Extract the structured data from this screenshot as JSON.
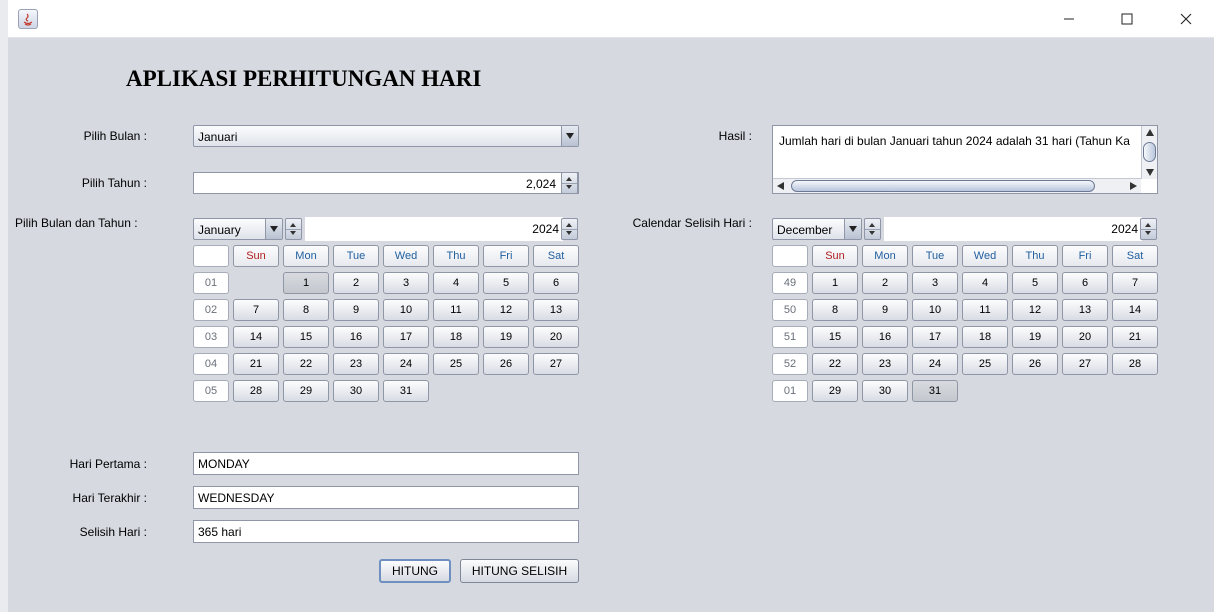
{
  "app": {
    "title": "APLIKASI PERHITUNGAN HARI"
  },
  "labels": {
    "pilih_bulan": "Pilih Bulan :",
    "pilih_tahun": "Pilih Tahun :",
    "pilih_bulan_tahun": "Pilih Bulan dan Tahun :",
    "hasil": "Hasil :",
    "calendar_selisih": "Calendar Selisih Hari :",
    "hari_pertama": "Hari Pertama :",
    "hari_terakhir": "Hari Terakhir :",
    "selisih_hari": "Selisih Hari :"
  },
  "inputs": {
    "bulan_value": "Januari",
    "tahun_value": "2,024",
    "hari_pertama_value": "MONDAY",
    "hari_terakhir_value": "WEDNESDAY",
    "selisih_hari_value": "365 hari"
  },
  "hasil": {
    "text": "Jumlah hari di bulan Januari tahun 2024 adalah 31 hari (Tahun Ka"
  },
  "calendar_left": {
    "month": "January",
    "year": "2024",
    "day_headers": [
      "Sun",
      "Mon",
      "Tue",
      "Wed",
      "Thu",
      "Fri",
      "Sat"
    ],
    "selected_day": "1",
    "weeks": [
      {
        "week": "01",
        "days": [
          "",
          "1",
          "2",
          "3",
          "4",
          "5",
          "6"
        ]
      },
      {
        "week": "02",
        "days": [
          "7",
          "8",
          "9",
          "10",
          "11",
          "12",
          "13"
        ]
      },
      {
        "week": "03",
        "days": [
          "14",
          "15",
          "16",
          "17",
          "18",
          "19",
          "20"
        ]
      },
      {
        "week": "04",
        "days": [
          "21",
          "22",
          "23",
          "24",
          "25",
          "26",
          "27"
        ]
      },
      {
        "week": "05",
        "days": [
          "28",
          "29",
          "30",
          "31",
          "",
          "",
          ""
        ]
      }
    ]
  },
  "calendar_right": {
    "month": "December",
    "year": "2024",
    "day_headers": [
      "Sun",
      "Mon",
      "Tue",
      "Wed",
      "Thu",
      "Fri",
      "Sat"
    ],
    "selected_day": "31",
    "weeks": [
      {
        "week": "49",
        "days": [
          "1",
          "2",
          "3",
          "4",
          "5",
          "6",
          "7"
        ]
      },
      {
        "week": "50",
        "days": [
          "8",
          "9",
          "10",
          "11",
          "12",
          "13",
          "14"
        ]
      },
      {
        "week": "51",
        "days": [
          "15",
          "16",
          "17",
          "18",
          "19",
          "20",
          "21"
        ]
      },
      {
        "week": "52",
        "days": [
          "22",
          "23",
          "24",
          "25",
          "26",
          "27",
          "28"
        ]
      },
      {
        "week": "01",
        "days": [
          "29",
          "30",
          "31",
          "",
          "",
          "",
          ""
        ]
      }
    ]
  },
  "buttons": {
    "hitung": "HITUNG",
    "hitung_selisih": "HITUNG SELISIH"
  }
}
